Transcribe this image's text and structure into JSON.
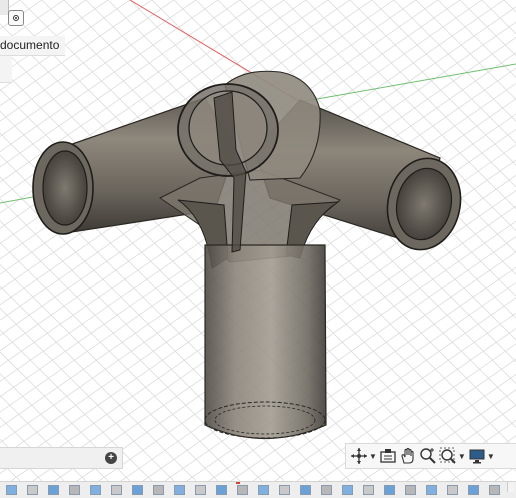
{
  "browser": {
    "document_label": "documento"
  },
  "viewport": {
    "axis_colors": {
      "x_axis": "#e06060",
      "y_axis": "#6fbf6f",
      "z_axis": "#6fa8dc"
    },
    "model": "tee-tube-connector"
  },
  "navbar": {
    "tools": [
      "orbit-icon",
      "look-at-icon",
      "pan-icon",
      "zoom-icon",
      "fit-icon",
      "display-settings-icon"
    ]
  },
  "timeline": {
    "feature_count": 24
  },
  "comments": {
    "add_icon": "plus-icon"
  }
}
